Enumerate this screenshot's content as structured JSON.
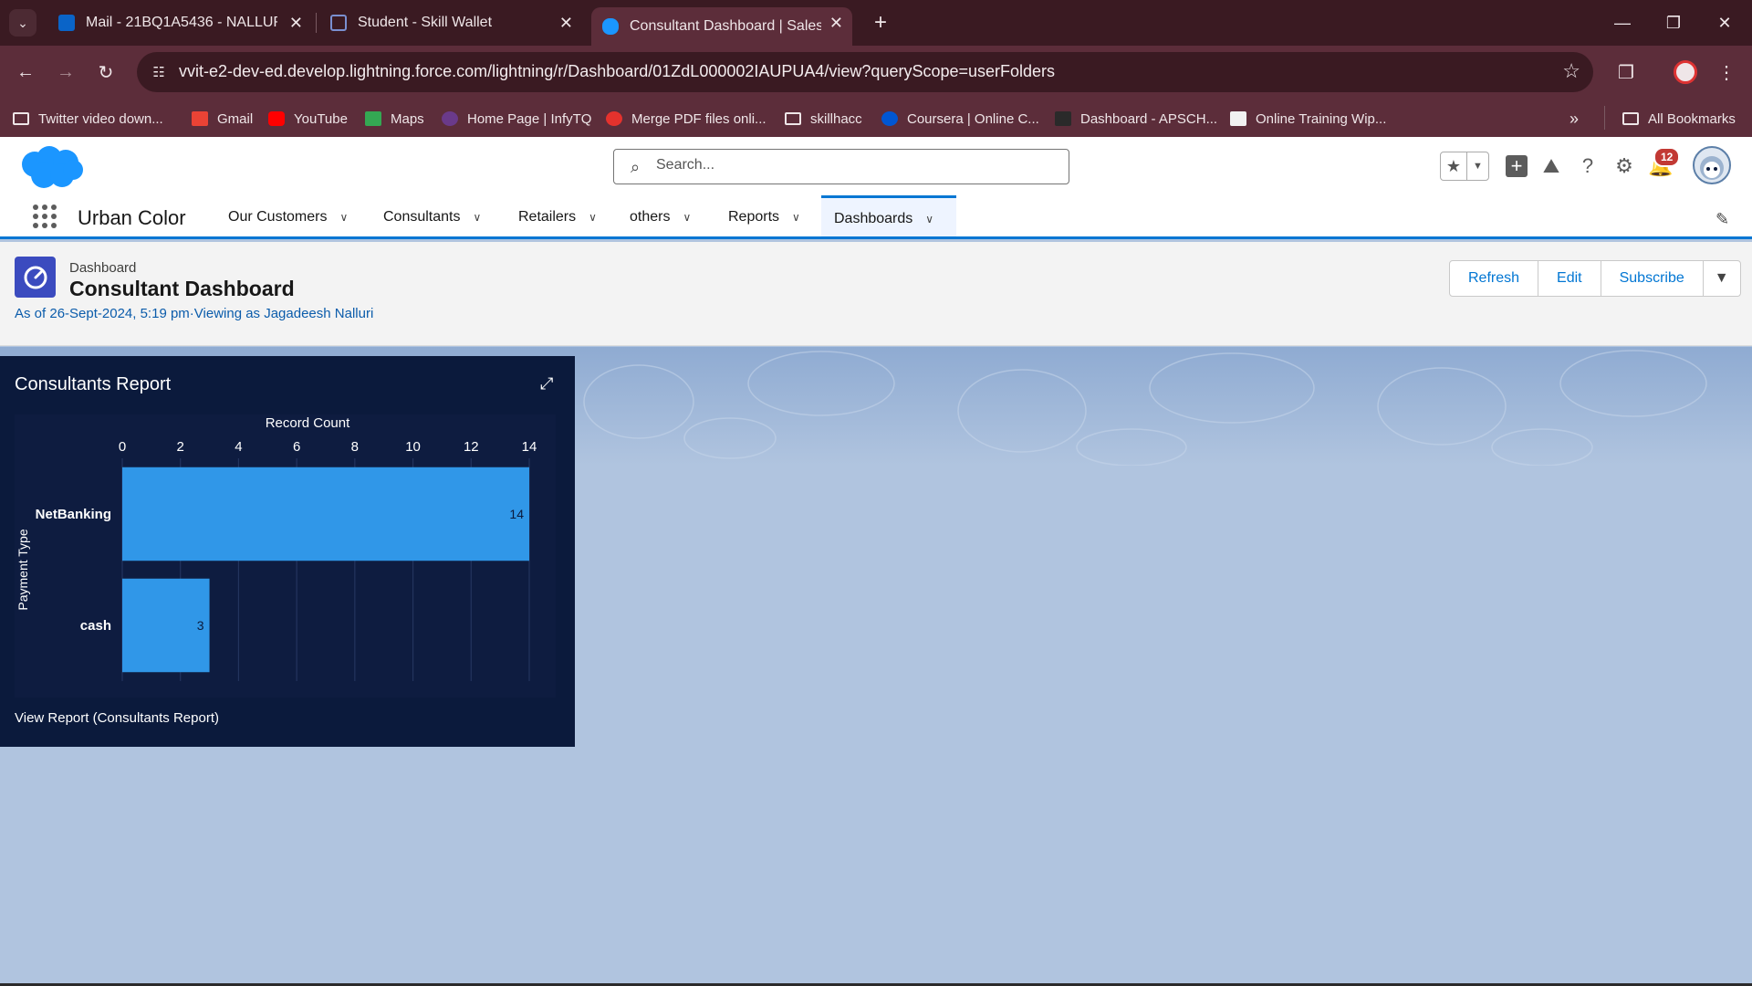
{
  "browser": {
    "tabs": [
      {
        "title": "Mail - 21BQ1A5436 - NALLURI J",
        "active": false
      },
      {
        "title": "Student - Skill Wallet",
        "active": false
      },
      {
        "title": "Consultant Dashboard | Salesfor",
        "active": true
      }
    ],
    "url": "vvit-e2-dev-ed.develop.lightning.force.com/lightning/r/Dashboard/01ZdL000002IAUPUA4/view?queryScope=userFolders",
    "bookmarks": [
      {
        "label": "Twitter video down...",
        "icon": "folder-icon"
      },
      {
        "label": "Gmail",
        "icon": "gmail-icon"
      },
      {
        "label": "YouTube",
        "icon": "youtube-icon"
      },
      {
        "label": "Maps",
        "icon": "maps-icon"
      },
      {
        "label": "Home Page | InfyTQ",
        "icon": "infytq-icon"
      },
      {
        "label": "Merge PDF files onli...",
        "icon": "pdf-icon"
      },
      {
        "label": "skillhacc",
        "icon": "folder-icon"
      },
      {
        "label": "Coursera | Online C...",
        "icon": "coursera-icon"
      },
      {
        "label": "Dashboard - APSCH...",
        "icon": "edx-icon"
      },
      {
        "label": "Online Training Wip...",
        "icon": "page-icon"
      }
    ],
    "all_bookmarks": "All Bookmarks",
    "colors": {
      "frame": "#3a1a22",
      "toolbar": "#5c2d3a"
    }
  },
  "salesforce": {
    "search_placeholder": "Search...",
    "notification_count": "12",
    "app_name": "Urban Color",
    "nav": [
      {
        "label": "Our Customers",
        "active": false
      },
      {
        "label": "Consultants",
        "active": false
      },
      {
        "label": "Retailers",
        "active": false
      },
      {
        "label": "others",
        "active": false
      },
      {
        "label": "Reports",
        "active": false
      },
      {
        "label": "Dashboards",
        "active": true
      }
    ],
    "colors": {
      "brand": "#0176d3",
      "cloud": "#1b96ff"
    }
  },
  "dashboard": {
    "kicker": "Dashboard",
    "title": "Consultant Dashboard",
    "as_of": "As of 26-Sept-2024, 5:19 pm·Viewing as Jagadeesh Nalluri",
    "buttons": {
      "refresh": "Refresh",
      "edit": "Edit",
      "subscribe": "Subscribe"
    }
  },
  "widget": {
    "title": "Consultants Report",
    "link": "View Report (Consultants Report)"
  },
  "chart_data": {
    "type": "bar",
    "orientation": "horizontal",
    "title": "",
    "xlabel": "Record Count",
    "ylabel": "Payment Type",
    "categories": [
      "NetBanking",
      "cash"
    ],
    "values": [
      14,
      3
    ],
    "xticks": [
      0,
      2,
      4,
      6,
      8,
      10,
      12,
      14
    ],
    "xlim": [
      0,
      14
    ],
    "grid": true,
    "bar_color": "#3097e8"
  }
}
